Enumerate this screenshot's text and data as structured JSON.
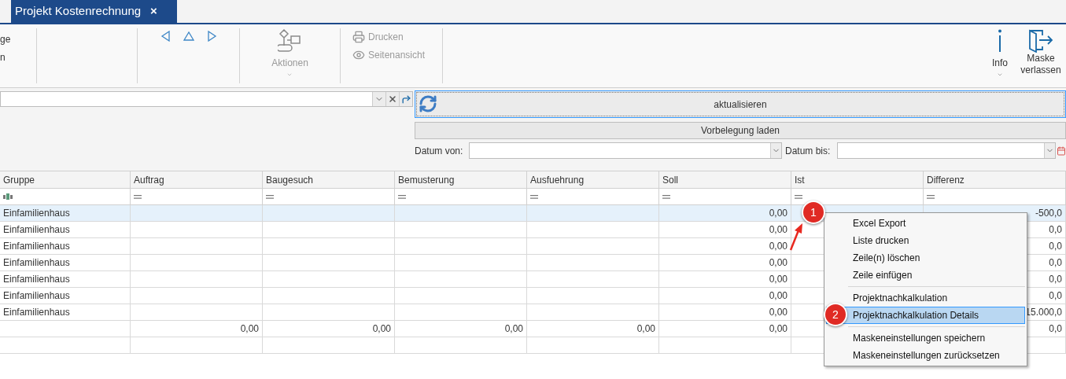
{
  "tab": {
    "title": "Projekt Kostenrechnung",
    "close": "×",
    "selected": true
  },
  "ribbon": {
    "cut_labels": [
      "ge",
      "n"
    ],
    "actions": {
      "label": "Aktionen",
      "disabled": true
    },
    "print": [
      {
        "kind": "printer",
        "label": "Drucken",
        "disabled": true
      },
      {
        "kind": "preview",
        "label": "Seitenansicht",
        "disabled": true
      }
    ],
    "info": {
      "label": "Info"
    },
    "exit": {
      "label_lines": [
        "Maske",
        "verlassen"
      ]
    }
  },
  "filter": {
    "refresh_button": "aktualisieren",
    "preset_button": "Vorbelegung laden",
    "date_from": {
      "label": "Datum von:"
    },
    "date_to": {
      "label": "Datum bis:"
    }
  },
  "table": {
    "columns": [
      {
        "label": "Gruppe",
        "kind": "text"
      },
      {
        "label": "Auftrag",
        "kind": "number"
      },
      {
        "label": "Baugesuch",
        "kind": "number"
      },
      {
        "label": "Bemusterung",
        "kind": "number"
      },
      {
        "label": "Ausfuehrung",
        "kind": "number"
      },
      {
        "label": "Soll",
        "kind": "number"
      },
      {
        "label": "Ist",
        "kind": "number"
      },
      {
        "label": "Differenz",
        "kind": "number"
      }
    ],
    "rows": [
      {
        "selected": true,
        "group": "Einfamilienhaus",
        "soll": "0,00",
        "differenz": "-500,0"
      },
      {
        "selected": false,
        "group": "Einfamilienhaus",
        "soll": "0,00",
        "differenz": "0,0"
      },
      {
        "selected": false,
        "group": "Einfamilienhaus",
        "soll": "0,00",
        "differenz": "0,0"
      },
      {
        "selected": false,
        "group": "Einfamilienhaus",
        "soll": "0,00",
        "differenz": "0,0"
      },
      {
        "selected": false,
        "group": "Einfamilienhaus",
        "soll": "0,00",
        "differenz": "0,0"
      },
      {
        "selected": false,
        "group": "Einfamilienhaus",
        "soll": "0,00",
        "differenz": "0,0"
      },
      {
        "selected": false,
        "group": "Einfamilienhaus",
        "soll": "0,00",
        "differenz": "15.000,0"
      }
    ],
    "total_row": {
      "sums": [
        "0,00",
        "0,00",
        "0,00",
        "0,00",
        "0,00"
      ],
      "differenz": "0,0"
    }
  },
  "context_menu": {
    "groups": [
      [
        {
          "label": "Excel Export",
          "selected": false
        },
        {
          "label": "Liste drucken",
          "selected": false
        },
        {
          "label": "Zeile(n) löschen",
          "selected": false
        },
        {
          "label": "Zeile einfügen",
          "selected": false
        }
      ],
      [
        {
          "label": "Projektnachkalkulation",
          "selected": false
        },
        {
          "label": "Projektnachkalkulation Details",
          "selected": true
        }
      ],
      [
        {
          "label": "Maskeneinstellungen speichern",
          "selected": false
        },
        {
          "label": "Maskeneinstellungen zurücksetzen",
          "selected": false
        }
      ]
    ]
  },
  "callouts": [
    {
      "number": "1",
      "arrow": true
    },
    {
      "number": "2"
    }
  ]
}
